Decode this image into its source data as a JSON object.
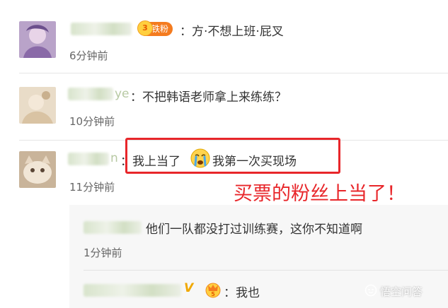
{
  "comments": [
    {
      "badge": "铁粉",
      "text": "：方·不想上班·屁叉",
      "time": "6分钟前"
    },
    {
      "username_visible": "ye",
      "text": "：不把韩语老师拿上来练练？",
      "time": "10分钟前"
    },
    {
      "username_visible": "n",
      "text_before_emoji": "：我上当了",
      "emoji": "crying-face-emoji",
      "text_after_emoji": "我第一次买现场",
      "time": "11分钟前"
    }
  ],
  "replies": [
    {
      "text": "他们一队都没打过训练赛，这你不知道啊",
      "time": "1分钟前"
    },
    {
      "verified": "V",
      "text": "：我也"
    }
  ],
  "annotation": {
    "text": "买票的粉丝上当了！",
    "color": "#e8262a"
  },
  "watermark": {
    "text": "悟空问答",
    "icon": "wukong-logo-icon"
  }
}
